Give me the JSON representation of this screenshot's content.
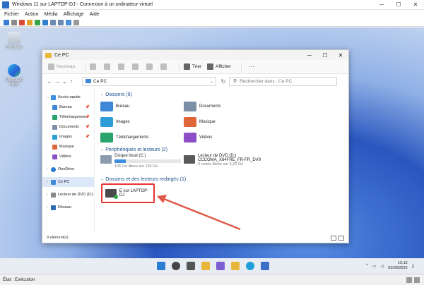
{
  "vm": {
    "title": "Windows 11 sur LAPTOP-DJ - Connexion à un ordinateur virtuel",
    "menu": [
      "Fichier",
      "Action",
      "Média",
      "Affichage",
      "Aide"
    ],
    "status": "État : Exécution"
  },
  "desktop": {
    "icons": [
      {
        "label": "Corbeille",
        "icon": "recycle-bin-icon"
      },
      {
        "label": "Microsoft Edge",
        "icon": "edge-icon"
      }
    ]
  },
  "explorer": {
    "title": "Ce PC",
    "commands": {
      "new": "Nouveau",
      "sort": "Trier",
      "view": "Afficher",
      "more": "···"
    },
    "address": "Ce PC",
    "search_placeholder": "Rechercher dans : Ce PC",
    "sidebar": [
      {
        "label": "Accès rapide",
        "icon": "star-icon"
      },
      {
        "label": "Bureau",
        "icon": "desktop-folder-icon"
      },
      {
        "label": "Téléchargemen",
        "icon": "download-icon"
      },
      {
        "label": "Documents",
        "icon": "documents-icon"
      },
      {
        "label": "Images",
        "icon": "images-icon"
      },
      {
        "label": "Musique",
        "icon": "music-icon"
      },
      {
        "label": "Vidéos",
        "icon": "videos-icon"
      },
      {
        "label": "OneDrive",
        "icon": "cloud-icon"
      },
      {
        "label": "Ce PC",
        "icon": "pc-icon"
      },
      {
        "label": "Lecteur de DVD (D:)",
        "icon": "dvd-icon"
      },
      {
        "label": "Réseau",
        "icon": "network-icon"
      }
    ],
    "groups": {
      "folders": {
        "header": "Dossiers (6)",
        "items": [
          {
            "label": "Bureau",
            "color": "#3f88d8"
          },
          {
            "label": "Documents",
            "color": "#7b8fa6"
          },
          {
            "label": "Images",
            "color": "#2f9ed8"
          },
          {
            "label": "Musique",
            "color": "#e0663a"
          },
          {
            "label": "Téléchargements",
            "color": "#27a36b"
          },
          {
            "label": "Vidéos",
            "color": "#8d4fc7"
          }
        ]
      },
      "drives": {
        "header": "Périphériques et lecteurs (2)",
        "local": {
          "name": "Disque local (C:)",
          "free": "105 Go libres sur 126 Go",
          "used_fraction": 0.17
        },
        "dvd": {
          "name": "Lecteur de DVD (D:)",
          "label": "CCCOMA_X64FRE_FR-FR_DV9",
          "free": "0 octets libres sur 5,20 Go"
        }
      },
      "redirected": {
        "header": "Dossiers et des lecteurs redirigés (1)",
        "item": "E sur LAPTOP-DJ"
      }
    },
    "status": "9 élément(s)"
  },
  "taskbar": {
    "time": "12:12",
    "date": "02/08/2022"
  },
  "colors": {
    "accent": "#3c8ee0",
    "highlight": "#e53535"
  }
}
